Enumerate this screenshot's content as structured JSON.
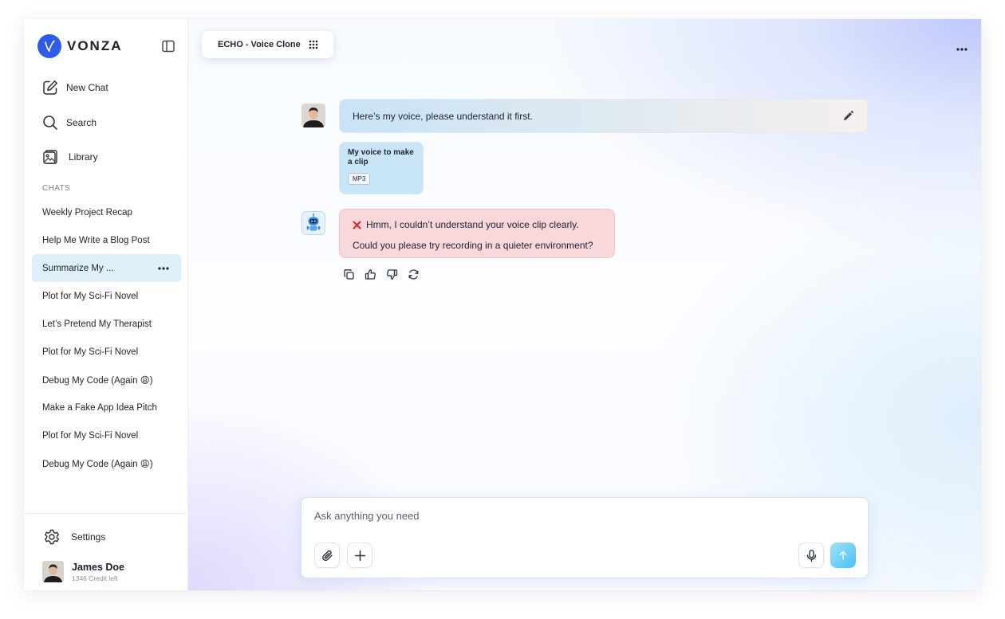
{
  "brand": {
    "name": "VONZA",
    "accent": "#2f5ce6"
  },
  "nav": {
    "new_chat": "New Chat",
    "search": "Search",
    "library": "Library"
  },
  "chats": {
    "heading": "CHATS",
    "items": [
      "Weekly Project Recap",
      "Help Me Write a Blog Post",
      "Summarize My ...",
      "Plot for My Sci-Fi Novel",
      "Let’s Pretend My Therapist",
      "Plot for My Sci-Fi Novel",
      "Debug My Code (Again 😩)",
      "Make a Fake App Idea Pitch",
      "Plot for My Sci-Fi Novel",
      "Debug My Code (Again 😩)"
    ],
    "active_index": 2
  },
  "footer": {
    "settings": "Settings",
    "user_name": "James Doe",
    "user_credit": "1346 Credit left"
  },
  "header": {
    "topic": "ECHO - Voice Clone"
  },
  "messages": {
    "user_text": "Here’s my voice, please understand it first.",
    "attachment_title": "My voice to make a clip",
    "attachment_type": "MP3",
    "error_line1": "Hmm, I couldn’t understand your voice clip clearly.",
    "error_line2": "Could you please try recording in a quieter environment?"
  },
  "composer": {
    "placeholder": "Ask anything you need"
  },
  "colors": {
    "active_chat": "#dff0fb",
    "error_bg": "#f8d8da",
    "error_x": "#e02424",
    "send": "#4bc0f3"
  }
}
